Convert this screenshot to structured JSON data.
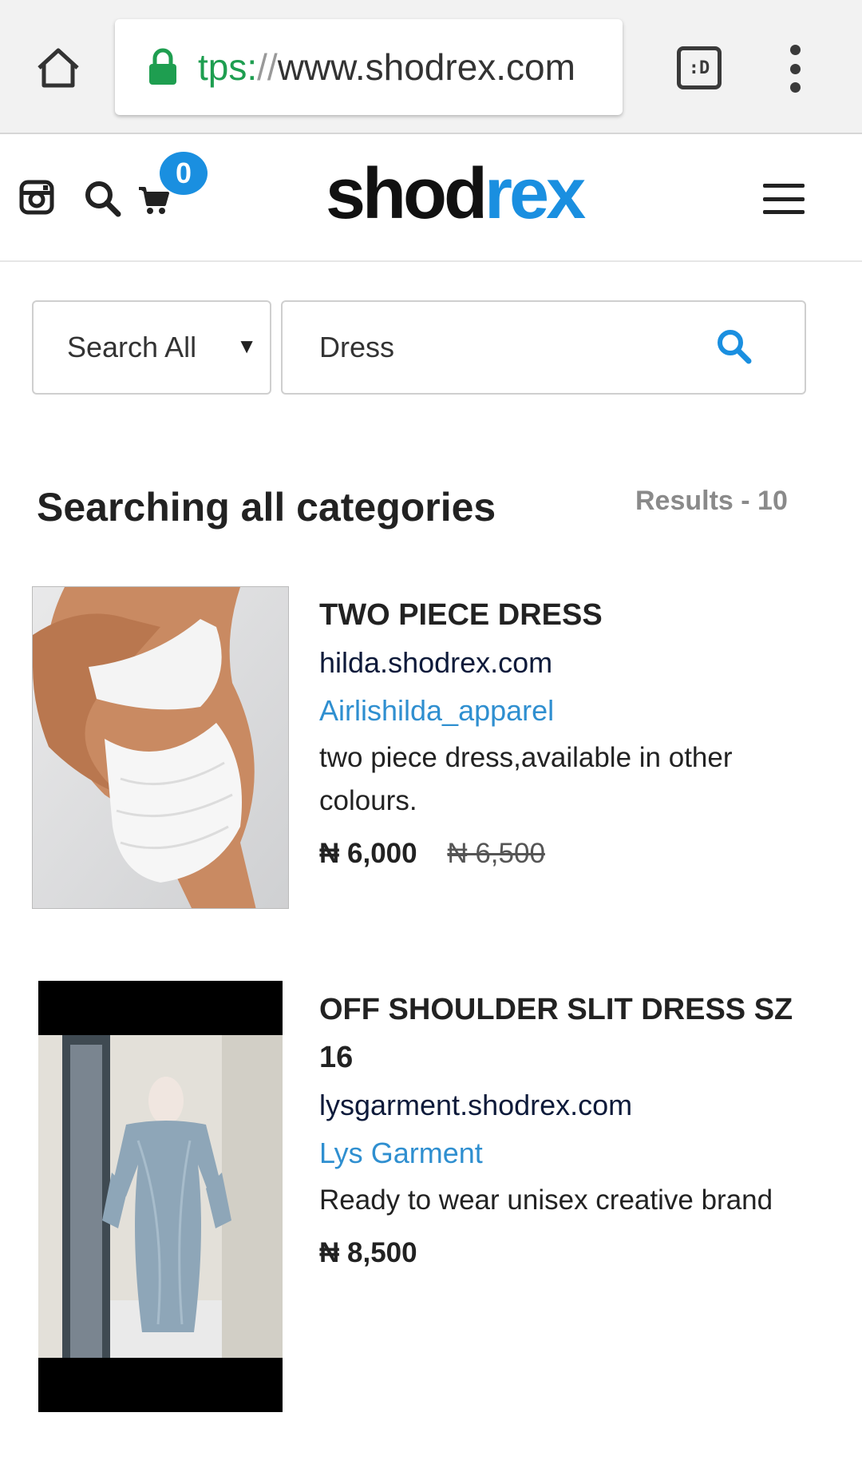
{
  "browser": {
    "url_scheme": "tps:",
    "url_sep": "//",
    "url_host": "www.shodrex.com",
    "tab_button_label": ":D"
  },
  "header": {
    "logo_part1": "shod",
    "logo_part2": "rex",
    "cart_count": "0",
    "brand_color": "#1a8fe0"
  },
  "search": {
    "category_selected": "Search All",
    "category_arrow": "▼",
    "query": "Dress"
  },
  "results": {
    "title": "Searching all categories",
    "count_label": "Results - 10"
  },
  "products": [
    {
      "title": "TWO PIECE DRESS",
      "domain": "hilda.shodrex.com",
      "seller": "Airlishilda_apparel",
      "description": "two piece dress,available in other colours.",
      "price": "₦ 6,000",
      "old_price": "₦ 6,500"
    },
    {
      "title": "OFF SHOULDER SLIT DRESS SZ 16",
      "domain": "lysgarment.shodrex.com",
      "seller": "Lys Garment",
      "description": "Ready to wear unisex creative brand",
      "price": "₦ 8,500"
    }
  ]
}
